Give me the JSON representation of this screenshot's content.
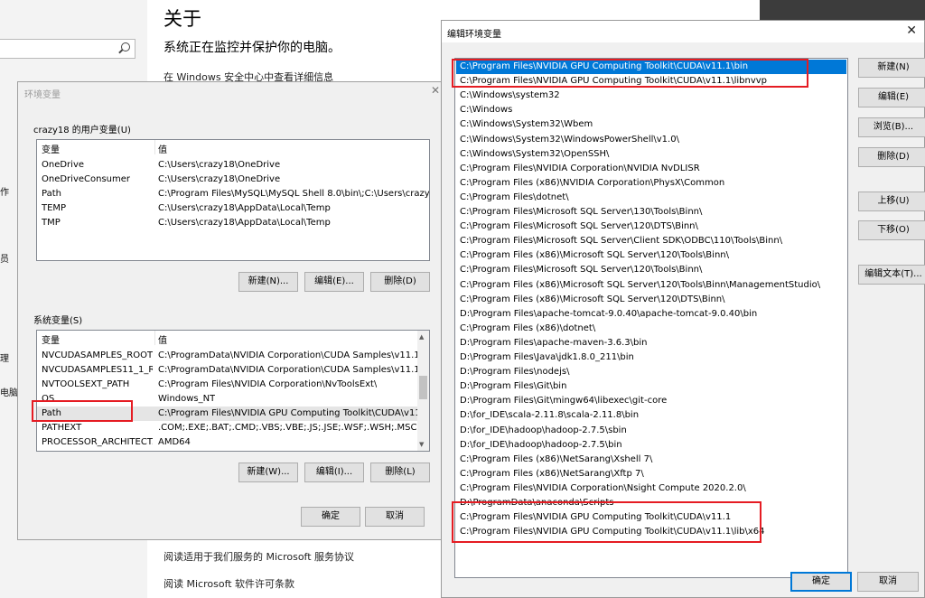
{
  "settings": {
    "title": "关于",
    "subtitle": "系统正在监控并保护你的电脑。",
    "security_link": "在 Windows 安全中心中查看详细信息",
    "footer_links": [
      "阅读适用于我们服务的 Microsoft 服务协议",
      "阅读 Microsoft 软件许可条款"
    ],
    "left_fragments": [
      "作",
      "员",
      "理",
      "电脑"
    ]
  },
  "env_dialog": {
    "title": "环境变量",
    "user_section_label": "crazy18 的用户变量(U)",
    "system_section_label": "系统变量(S)",
    "col_var": "变量",
    "col_val": "值",
    "user_vars": [
      {
        "name": "OneDrive",
        "value": "C:\\Users\\crazy18\\OneDrive"
      },
      {
        "name": "OneDriveConsumer",
        "value": "C:\\Users\\crazy18\\OneDrive"
      },
      {
        "name": "Path",
        "value": "C:\\Program Files\\MySQL\\MySQL Shell 8.0\\bin\\;C:\\Users\\crazy..."
      },
      {
        "name": "TEMP",
        "value": "C:\\Users\\crazy18\\AppData\\Local\\Temp"
      },
      {
        "name": "TMP",
        "value": "C:\\Users\\crazy18\\AppData\\Local\\Temp"
      }
    ],
    "system_vars": [
      {
        "name": "NVCUDASAMPLES_ROOT",
        "value": "C:\\ProgramData\\NVIDIA Corporation\\CUDA Samples\\v11.1"
      },
      {
        "name": "NVCUDASAMPLES11_1_R...",
        "value": "C:\\ProgramData\\NVIDIA Corporation\\CUDA Samples\\v11.1"
      },
      {
        "name": "NVTOOLSEXT_PATH",
        "value": "C:\\Program Files\\NVIDIA Corporation\\NvToolsExt\\"
      },
      {
        "name": "OS",
        "value": "Windows_NT"
      },
      {
        "name": "Path",
        "value": "C:\\Program Files\\NVIDIA GPU Computing Toolkit\\CUDA\\v11...."
      },
      {
        "name": "PATHEXT",
        "value": ".COM;.EXE;.BAT;.CMD;.VBS;.VBE;.JS;.JSE;.WSF;.WSH;.MSC"
      },
      {
        "name": "PROCESSOR_ARCHITECT...",
        "value": "AMD64"
      }
    ],
    "user_buttons": {
      "new": "新建(N)...",
      "edit": "编辑(E)...",
      "delete": "删除(D)"
    },
    "system_buttons": {
      "new": "新建(W)...",
      "edit": "编辑(I)...",
      "delete": "删除(L)"
    },
    "ok": "确定",
    "cancel": "取消"
  },
  "edit_dialog": {
    "title": "编辑环境变量",
    "close_glyph": "✕",
    "paths": [
      "C:\\Program Files\\NVIDIA GPU Computing Toolkit\\CUDA\\v11.1\\bin",
      "C:\\Program Files\\NVIDIA GPU Computing Toolkit\\CUDA\\v11.1\\libnvvp",
      "C:\\Windows\\system32",
      "C:\\Windows",
      "C:\\Windows\\System32\\Wbem",
      "C:\\Windows\\System32\\WindowsPowerShell\\v1.0\\",
      "C:\\Windows\\System32\\OpenSSH\\",
      "C:\\Program Files\\NVIDIA Corporation\\NVIDIA NvDLISR",
      "C:\\Program Files (x86)\\NVIDIA Corporation\\PhysX\\Common",
      "C:\\Program Files\\dotnet\\",
      "C:\\Program Files\\Microsoft SQL Server\\130\\Tools\\Binn\\",
      "C:\\Program Files\\Microsoft SQL Server\\120\\DTS\\Binn\\",
      "C:\\Program Files\\Microsoft SQL Server\\Client SDK\\ODBC\\110\\Tools\\Binn\\",
      "C:\\Program Files (x86)\\Microsoft SQL Server\\120\\Tools\\Binn\\",
      "C:\\Program Files\\Microsoft SQL Server\\120\\Tools\\Binn\\",
      "C:\\Program Files (x86)\\Microsoft SQL Server\\120\\Tools\\Binn\\ManagementStudio\\",
      "C:\\Program Files (x86)\\Microsoft SQL Server\\120\\DTS\\Binn\\",
      "D:\\Program Files\\apache-tomcat-9.0.40\\apache-tomcat-9.0.40\\bin",
      "C:\\Program Files (x86)\\dotnet\\",
      "D:\\Program Files\\apache-maven-3.6.3\\bin",
      "D:\\Program Files\\Java\\jdk1.8.0_211\\bin",
      "D:\\Program Files\\nodejs\\",
      "D:\\Program Files\\Git\\bin",
      "D:\\Program Files\\Git\\mingw64\\libexec\\git-core",
      "D:\\for_IDE\\scala-2.11.8\\scala-2.11.8\\bin",
      "D:\\for_IDE\\hadoop\\hadoop-2.7.5\\sbin",
      "D:\\for_IDE\\hadoop\\hadoop-2.7.5\\bin",
      "C:\\Program Files (x86)\\NetSarang\\Xshell 7\\",
      "C:\\Program Files (x86)\\NetSarang\\Xftp 7\\",
      "C:\\Program Files\\NVIDIA Corporation\\Nsight Compute 2020.2.0\\",
      "D:\\ProgramData\\anaconda\\Scripts",
      "C:\\Program Files\\NVIDIA GPU Computing Toolkit\\CUDA\\v11.1",
      "C:\\Program Files\\NVIDIA GPU Computing Toolkit\\CUDA\\v11.1\\lib\\x64"
    ],
    "buttons": {
      "new": "新建(N)",
      "edit": "编辑(E)",
      "browse": "浏览(B)...",
      "delete": "删除(D)",
      "move_up": "上移(U)",
      "move_down": "下移(O)",
      "edit_text": "编辑文本(T)..."
    },
    "ok": "确定",
    "cancel": "取消"
  },
  "colors": {
    "highlight_box": "#e51c23",
    "selection": "#0078d7"
  }
}
